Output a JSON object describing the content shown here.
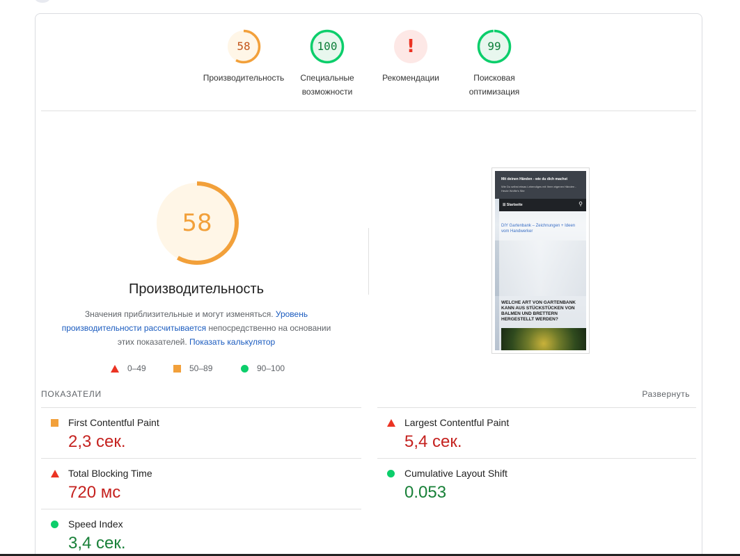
{
  "colors": {
    "poor": "#eb3323",
    "average": "#f2a03a",
    "good": "#0cce6b",
    "link": "#1a5bbf",
    "value_red": "#c5221f",
    "value_green": "#188038"
  },
  "categories": [
    {
      "score": "58",
      "label": "Производительность",
      "status": "average"
    },
    {
      "score": "100",
      "label": "Специальные возможности",
      "status": "good"
    },
    {
      "score": "!",
      "label": "Рекомендации",
      "status": "poor"
    },
    {
      "score": "99",
      "label": "Поисковая оптимизация",
      "status": "good"
    }
  ],
  "performance": {
    "score": "58",
    "title": "Производительность",
    "desc_part1": "Значения приблизительные и могут изменяться. ",
    "desc_link1": "Уровень производительности рассчитывается",
    "desc_part2": " непосредственно на основании этих показателей. ",
    "desc_link2": "Показать калькулятор"
  },
  "legend": [
    {
      "label": "0–49",
      "icon": "triangle-icon"
    },
    {
      "label": "50–89",
      "icon": "square-icon"
    },
    {
      "label": "90–100",
      "icon": "circle-icon"
    }
  ],
  "screenshot": {
    "header_title": "Mit deinen Händen - wie du dich machst",
    "header_sub": "Wie Du selbst etwas Lebendiges mit Ihren eigenen Händen - Heute Wolfie's Site",
    "nav_label": "☰ Startseite",
    "link_title": "DIY Gartenbank – Zeichnungen + Ideen vom Handwerker",
    "heading": "WELCHE ART VON GARTENBANK KANN AUS STÜCKSTÜCKEN VON BALMEN UND BRETTERN HERGESTELLT WERDEN?"
  },
  "metrics": {
    "title": "ПОКАЗАТЕЛИ",
    "expand_label": "Развернуть",
    "items": [
      {
        "name": "First Contentful Paint",
        "value": "2,3 сек.",
        "status": "average"
      },
      {
        "name": "Largest Contentful Paint",
        "value": "5,4 сек.",
        "status": "poor"
      },
      {
        "name": "Total Blocking Time",
        "value": "720 мс",
        "status": "poor"
      },
      {
        "name": "Cumulative Layout Shift",
        "value": "0.053",
        "status": "good"
      },
      {
        "name": "Speed Index",
        "value": "3,4 сек.",
        "status": "good"
      }
    ]
  }
}
